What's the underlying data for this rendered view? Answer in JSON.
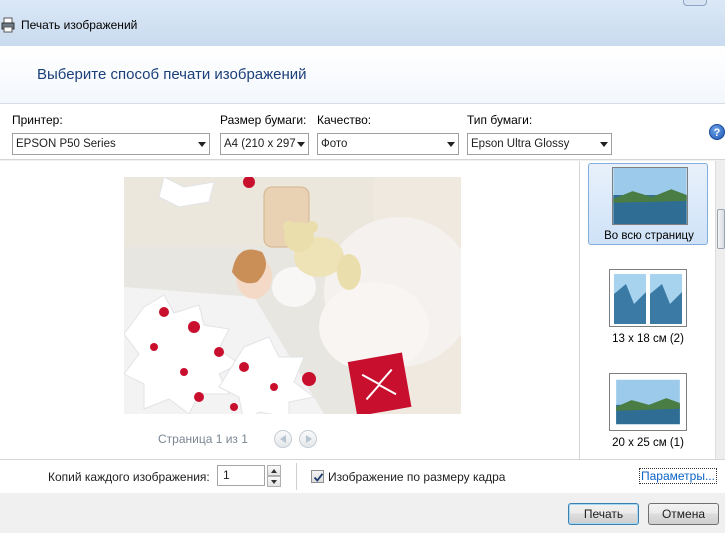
{
  "window": {
    "title": "Печать изображений"
  },
  "header": {
    "instruction": "Выберите способ печати изображений"
  },
  "options": {
    "printer": {
      "label": "Принтер:",
      "value": "EPSON P50 Series"
    },
    "paper_size": {
      "label": "Размер бумаги:",
      "value": "A4 (210 x 297"
    },
    "quality": {
      "label": "Качество:",
      "value": "Фото"
    },
    "paper_type": {
      "label": "Тип бумаги:",
      "value": "Epson Ultra Glossy"
    },
    "help_icon": "?"
  },
  "preview": {
    "page_status": "Страница 1 из 1"
  },
  "layouts": [
    {
      "caption": "Во всю страницу",
      "selected": true
    },
    {
      "caption": "13 x 18 см (2)",
      "selected": false
    },
    {
      "caption": "20 x 25 см (1)",
      "selected": false
    }
  ],
  "copies": {
    "label": "Копий каждого изображения:",
    "value": "1"
  },
  "fit_frame": {
    "label": "Изображение по размеру кадра",
    "checked": true
  },
  "params_link": "Параметры...",
  "buttons": {
    "print": "Печать",
    "cancel": "Отмена"
  },
  "colors": {
    "accent": "#1c3f7a",
    "link": "#0c63c6",
    "titlebar": "#c9dbef"
  }
}
